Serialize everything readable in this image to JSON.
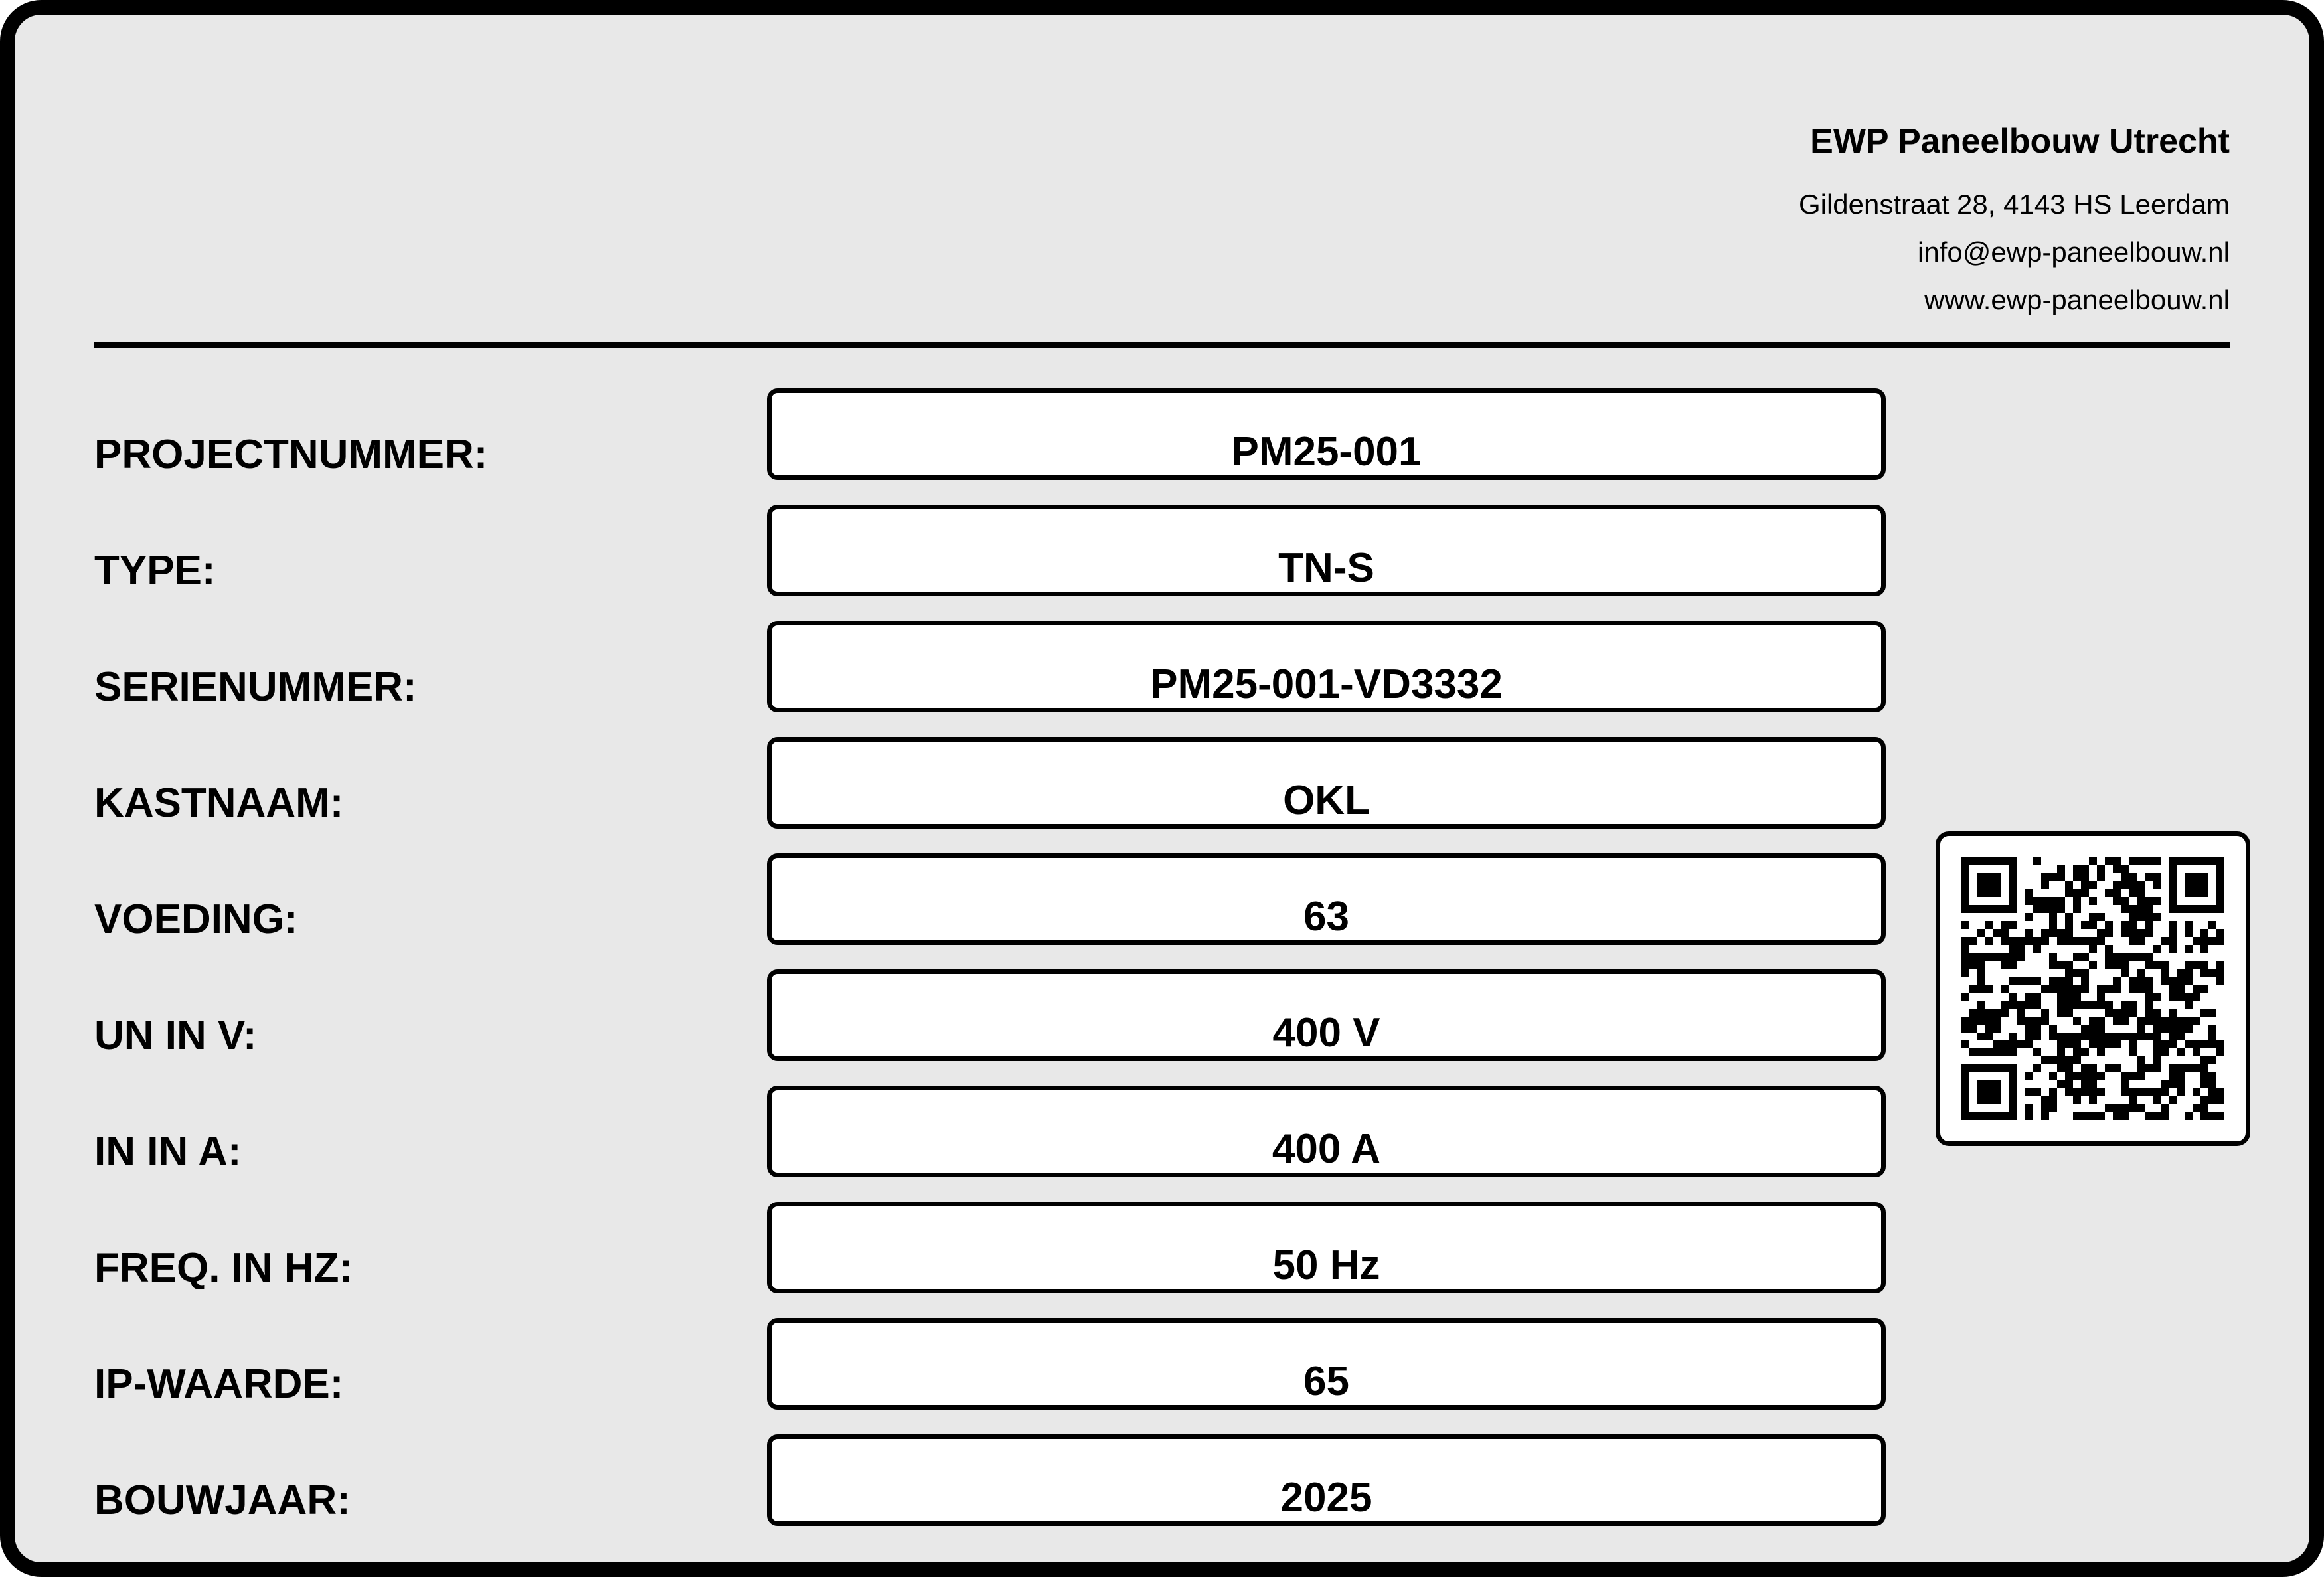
{
  "company": {
    "name": "EWP Paneelbouw Utrecht",
    "address": "Gildenstraat 28, 4143 HS Leerdam",
    "email": "info@ewp-paneelbouw.nl",
    "website": "www.ewp-paneelbouw.nl"
  },
  "fields": [
    {
      "label": "PROJECTNUMMER:",
      "value": "PM25-001"
    },
    {
      "label": "TYPE:",
      "value": "TN-S"
    },
    {
      "label": "SERIENUMMER:",
      "value": "PM25-001-VD3332"
    },
    {
      "label": "KASTNAAM:",
      "value": "OKL"
    },
    {
      "label": "VOEDING:",
      "value": "63"
    },
    {
      "label": "UN IN V:",
      "value": "400 V"
    },
    {
      "label": "IN IN A:",
      "value": "400 A"
    },
    {
      "label": "FREQ. IN HZ:",
      "value": "50 Hz"
    },
    {
      "label": "IP-WAARDE:",
      "value": "65"
    },
    {
      "label": "BOUWJAAR:",
      "value": "2025"
    }
  ],
  "qr_code": {
    "icon": "qr-code-icon"
  },
  "colors": {
    "plate": "#e8e8e8",
    "border": "#000000",
    "field_fill": "#ffffff"
  }
}
